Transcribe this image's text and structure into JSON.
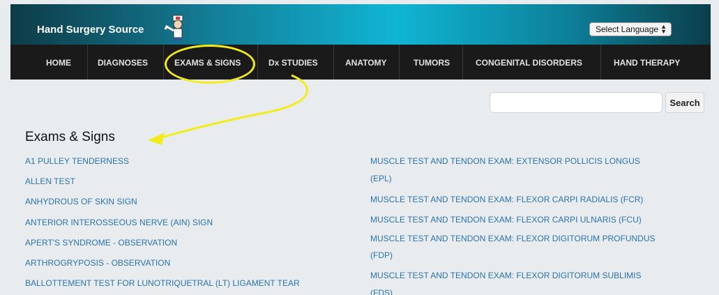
{
  "header": {
    "site_title": "Hand Surgery Source",
    "language_select": "Select Language"
  },
  "nav": {
    "items": [
      "HOME",
      "DIAGNOSES",
      "EXAMS & SIGNS",
      "Dx STUDIES",
      "ANATOMY",
      "TUMORS",
      "CONGENITAL DISORDERS",
      "HAND THERAPY"
    ],
    "active": "EXAMS & SIGNS"
  },
  "search": {
    "value": "",
    "button_label": "Search"
  },
  "page": {
    "title": "Exams & Signs"
  },
  "exams_left": [
    "A1 PULLEY TENDERNESS",
    "ALLEN TEST",
    "ANHYDROUS OF SKIN SIGN",
    "ANTERIOR INTEROSSEOUS NERVE (AIN) SIGN",
    "APERT'S SYNDROME - OBSERVATION",
    "ARTHROGRYPOSIS - OBSERVATION",
    "BALLOTTEMENT TEST FOR LUNOTRIQUETRAL (LT) LIGAMENT TEAR"
  ],
  "exams_right": [
    "MUSCLE TEST AND TENDON EXAM: EXTENSOR POLLICIS LONGUS",
    "(EPL)",
    "MUSCLE TEST AND TENDON EXAM: FLEXOR CARPI RADIALIS (FCR)",
    "MUSCLE TEST AND TENDON EXAM: FLEXOR CARPI ULNARIS (FCU)",
    "MUSCLE TEST AND TENDON EXAM: FLEXOR DIGITORUM PROFUNDUS",
    "(FDP)",
    "MUSCLE TEST AND TENDON EXAM: FLEXOR DIGITORUM SUBLIMIS",
    "(FDS)"
  ],
  "colors": {
    "link": "#2a73ad",
    "annotation": "#f2ec1c",
    "navbar": "#1a1a1a"
  }
}
